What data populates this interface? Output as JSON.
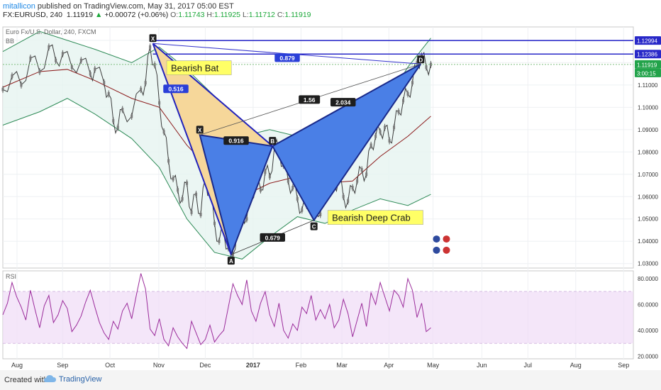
{
  "header": {
    "publisher": "mitallicon",
    "published_text": " published on TradingView.com, May 31, 2017 05:00 EST",
    "symbol": "FX:EURUSD, 240",
    "last": "1.11919",
    "change": "+0.00072 (+0.06%)",
    "o_label": "O:",
    "o": "1.11743",
    "h_label": "H:",
    "h": "1.11925",
    "l_label": "L:",
    "l": "1.11712",
    "c_label": "C:",
    "c": "1.11919"
  },
  "footer": {
    "created_with": "Created with",
    "brand": "TradingView"
  },
  "colors": {
    "pattern_blue": "#4a7fe6",
    "bat_fill": "#f6d79a",
    "level_line": "#2828c8",
    "rsi_line": "#9b2c9b",
    "rsi_band": "#f0dcf6",
    "bb_fill": "#e6f4f0",
    "ma_line": "#8b1a1a",
    "bb_line": "#2e8b57"
  },
  "chart_data": [
    {
      "type": "line",
      "title": "Euro Fx/U.S. Dollar, 240, FXCM",
      "indicator_label": "BB",
      "x_ticks": [
        "Aug",
        "Sep",
        "Oct",
        "Nov",
        "Dec",
        "2017",
        "Feb",
        "Mar",
        "Apr",
        "May",
        "Jun",
        "Jul",
        "Aug",
        "Sep"
      ],
      "y_ticks": [
        "1.13000",
        "1.12000",
        "1.11000",
        "1.10000",
        "1.09000",
        "1.08000",
        "1.07000",
        "1.06000",
        "1.05000",
        "1.04000",
        "1.03000"
      ],
      "ylim": [
        1.028,
        1.136
      ],
      "price_labels": [
        {
          "value": 1.12994,
          "text": "1.12994",
          "kind": "level"
        },
        {
          "value": 1.12386,
          "text": "1.12386",
          "kind": "level"
        },
        {
          "value": 1.11919,
          "text": "1.11919",
          "kind": "last"
        },
        {
          "value": 1.1155,
          "text": "3:00:15",
          "kind": "timer"
        }
      ],
      "price_path": [
        [
          0,
          1.108
        ],
        [
          2,
          1.114
        ],
        [
          4,
          1.11
        ],
        [
          6,
          1.122
        ],
        [
          8,
          1.116
        ],
        [
          10,
          1.127
        ],
        [
          11.5,
          1.121
        ],
        [
          13,
          1.124
        ],
        [
          15,
          1.118
        ],
        [
          17,
          1.121
        ],
        [
          19,
          1.115
        ],
        [
          20,
          1.117
        ],
        [
          22,
          1.111
        ],
        [
          23,
          1.106
        ],
        [
          24,
          1.094
        ],
        [
          25,
          1.091
        ],
        [
          26,
          1.099
        ],
        [
          28,
          1.096
        ],
        [
          30,
          1.108
        ],
        [
          31,
          1.111
        ],
        [
          32,
          1.127
        ],
        [
          33,
          1.119
        ],
        [
          34,
          1.102
        ],
        [
          35,
          1.089
        ],
        [
          36,
          1.076
        ],
        [
          37,
          1.068
        ],
        [
          38,
          1.063
        ],
        [
          39,
          1.059
        ],
        [
          40,
          1.066
        ],
        [
          41,
          1.053
        ],
        [
          42,
          1.061
        ],
        [
          43,
          1.052
        ],
        [
          44,
          1.068
        ],
        [
          45,
          1.061
        ],
        [
          46,
          1.048
        ],
        [
          47,
          1.04
        ],
        [
          48,
          1.044
        ],
        [
          49,
          1.037
        ],
        [
          50,
          1.034
        ],
        [
          51,
          1.047
        ],
        [
          52,
          1.054
        ],
        [
          53,
          1.05
        ],
        [
          54,
          1.061
        ],
        [
          55,
          1.066
        ],
        [
          56,
          1.063
        ],
        [
          57,
          1.071
        ],
        [
          58,
          1.069
        ],
        [
          59,
          1.082
        ],
        [
          60,
          1.081
        ],
        [
          61,
          1.074
        ],
        [
          62,
          1.067
        ],
        [
          63,
          1.064
        ],
        [
          64,
          1.059
        ],
        [
          65,
          1.054
        ],
        [
          66,
          1.056
        ],
        [
          67,
          1.061
        ],
        [
          68,
          1.058
        ],
        [
          69,
          1.052
        ],
        [
          70,
          1.063
        ],
        [
          71,
          1.067
        ],
        [
          72,
          1.065
        ],
        [
          73,
          1.068
        ],
        [
          74,
          1.06
        ],
        [
          75,
          1.058
        ],
        [
          76,
          1.064
        ],
        [
          77,
          1.067
        ],
        [
          78,
          1.072
        ],
        [
          79,
          1.07
        ],
        [
          80,
          1.083
        ],
        [
          81,
          1.087
        ],
        [
          82,
          1.089
        ],
        [
          83,
          1.091
        ],
        [
          84,
          1.085
        ],
        [
          85,
          1.091
        ],
        [
          86,
          1.098
        ],
        [
          87,
          1.103
        ],
        [
          88,
          1.106
        ],
        [
          89,
          1.111
        ],
        [
          90,
          1.12
        ],
        [
          91,
          1.123
        ],
        [
          92,
          1.118
        ],
        [
          93,
          1.1192
        ]
      ],
      "bb_upper": [
        [
          0,
          1.125
        ],
        [
          8,
          1.134
        ],
        [
          14,
          1.13
        ],
        [
          20,
          1.126
        ],
        [
          28,
          1.12
        ],
        [
          34,
          1.127
        ],
        [
          40,
          1.117
        ],
        [
          46,
          1.105
        ],
        [
          52,
          1.087
        ],
        [
          58,
          1.09
        ],
        [
          64,
          1.087
        ],
        [
          70,
          1.083
        ],
        [
          76,
          1.08
        ],
        [
          82,
          1.098
        ],
        [
          88,
          1.118
        ],
        [
          93,
          1.131
        ]
      ],
      "bb_lower": [
        [
          0,
          1.092
        ],
        [
          8,
          1.098
        ],
        [
          14,
          1.104
        ],
        [
          20,
          1.097
        ],
        [
          28,
          1.086
        ],
        [
          34,
          1.073
        ],
        [
          40,
          1.05
        ],
        [
          46,
          1.035
        ],
        [
          52,
          1.032
        ],
        [
          58,
          1.042
        ],
        [
          64,
          1.051
        ],
        [
          70,
          1.048
        ],
        [
          76,
          1.054
        ],
        [
          82,
          1.059
        ],
        [
          88,
          1.056
        ],
        [
          93,
          1.061
        ]
      ],
      "bb_mid": [
        [
          0,
          1.109
        ],
        [
          8,
          1.116
        ],
        [
          14,
          1.117
        ],
        [
          20,
          1.112
        ],
        [
          28,
          1.104
        ],
        [
          34,
          1.1
        ],
        [
          40,
          1.083
        ],
        [
          46,
          1.07
        ],
        [
          52,
          1.06
        ],
        [
          58,
          1.066
        ],
        [
          64,
          1.069
        ],
        [
          70,
          1.066
        ],
        [
          76,
          1.067
        ],
        [
          82,
          1.078
        ],
        [
          88,
          1.087
        ],
        [
          93,
          1.096
        ]
      ],
      "harmonic_patterns": [
        {
          "name": "Bearish Bat",
          "points": [
            {
              "label": "X",
              "x": 32.6,
              "y": 1.1286
            },
            {
              "label": "A",
              "x": 49.6,
              "y": 1.034
            },
            {
              "label": "B",
              "x": 41.6,
              "y": 1.0826
            },
            {
              "label": "C",
              "x": 42.8,
              "y": 1.0876
            }
          ],
          "ratios": [
            {
              "text": "0.516"
            }
          ]
        },
        {
          "name": "Bearish Deep Crab",
          "points": [
            {
              "label": "X",
              "x": 42.8,
              "y": 1.0876
            },
            {
              "label": "A",
              "x": 49.6,
              "y": 1.034
            },
            {
              "label": "B",
              "x": 58.6,
              "y": 1.0826
            },
            {
              "label": "C",
              "x": 67.6,
              "y": 1.0494
            },
            {
              "label": "D",
              "x": 90.8,
              "y": 1.1194
            }
          ],
          "ratios": [
            {
              "text": "0.916"
            },
            {
              "text": "1.56"
            },
            {
              "text": "2.034"
            },
            {
              "text": "0.679"
            },
            {
              "text": "0.879"
            }
          ]
        }
      ]
    },
    {
      "type": "line",
      "title": "",
      "indicator_label": "RSI",
      "y_ticks": [
        "80.0000",
        "60.0000",
        "40.0000",
        "20.0000"
      ],
      "ylim": [
        18,
        86
      ],
      "bands": [
        30,
        70
      ],
      "values": [
        52,
        61,
        77,
        66,
        58,
        48,
        71,
        56,
        42,
        59,
        67,
        46,
        52,
        63,
        57,
        39,
        44,
        51,
        62,
        71,
        58,
        46,
        38,
        33,
        47,
        41,
        55,
        61,
        49,
        67,
        84,
        72,
        41,
        36,
        49,
        33,
        28,
        42,
        35,
        30,
        26,
        47,
        38,
        29,
        33,
        44,
        31,
        36,
        40,
        58,
        76,
        67,
        60,
        79,
        55,
        47,
        61,
        70,
        52,
        43,
        61,
        40,
        34,
        45,
        40,
        58,
        53,
        67,
        48,
        56,
        49,
        60,
        42,
        48,
        64,
        53,
        35,
        48,
        61,
        43,
        69,
        60,
        77,
        66,
        55,
        71,
        67,
        58,
        80,
        71,
        50,
        61,
        39,
        42
      ]
    }
  ]
}
